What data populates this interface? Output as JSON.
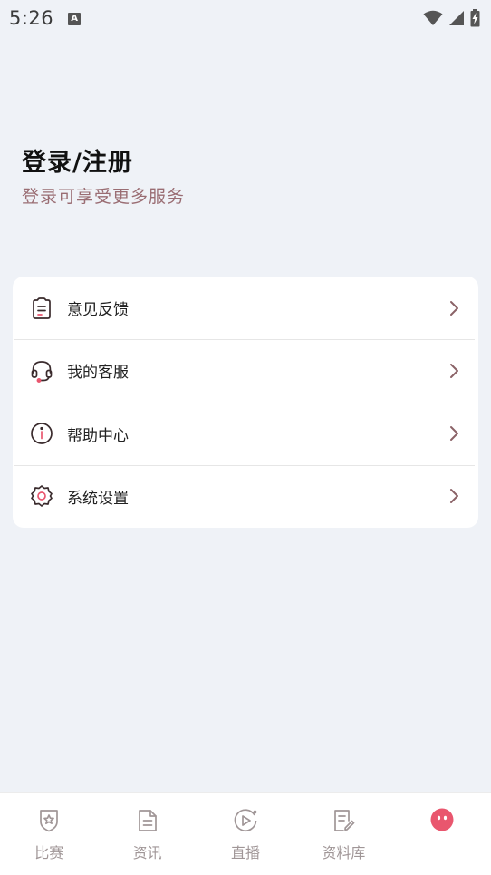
{
  "status_bar": {
    "time": "5:26",
    "badge": "A"
  },
  "header": {
    "title": "登录/注册",
    "subtitle": "登录可享受更多服务"
  },
  "menu": [
    {
      "label": "意见反馈",
      "icon": "feedback-icon"
    },
    {
      "label": "我的客服",
      "icon": "headset-icon"
    },
    {
      "label": "帮助中心",
      "icon": "info-icon"
    },
    {
      "label": "系统设置",
      "icon": "gear-icon"
    }
  ],
  "nav": [
    {
      "label": "比赛",
      "icon": "trophy-star-icon"
    },
    {
      "label": "资讯",
      "icon": "document-icon"
    },
    {
      "label": "直播",
      "icon": "play-circle-icon"
    },
    {
      "label": "资料库",
      "icon": "notebook-icon"
    },
    {
      "label": "",
      "icon": "profile-face-icon",
      "active": true
    }
  ],
  "colors": {
    "background": "#eff2f7",
    "accent": "#e9566e",
    "subtitle": "#9a6d73",
    "icon_stroke": "#3a2b2d",
    "nav_inactive": "#a09697",
    "chevron": "#8b6267"
  }
}
